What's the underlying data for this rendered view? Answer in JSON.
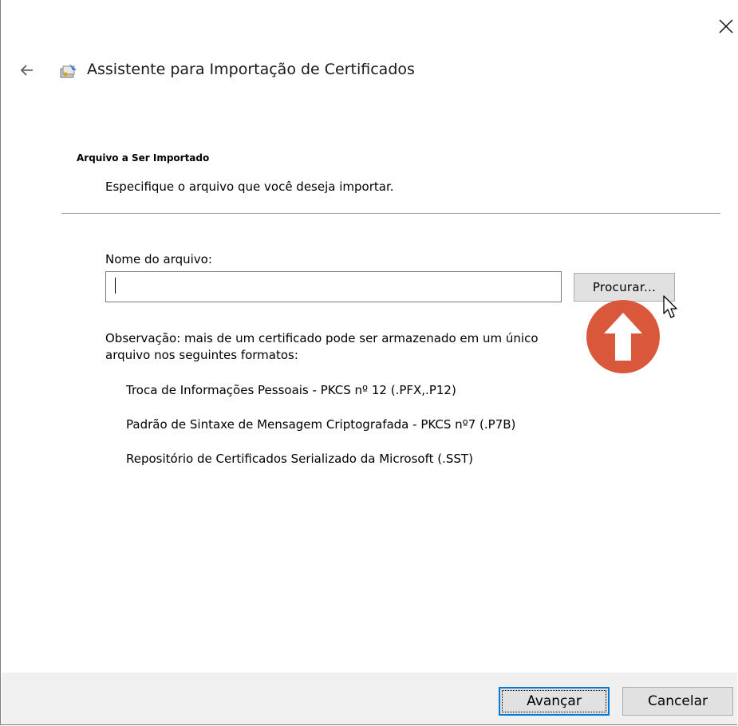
{
  "window": {
    "title": "Assistente para Importação de Certificados"
  },
  "page": {
    "heading": "Arquivo a Ser Importado",
    "subheading": "Especifique o arquivo que você deseja importar."
  },
  "file": {
    "label": "Nome do arquivo:",
    "value": "",
    "browse_label": "Procurar..."
  },
  "note": {
    "text": "Observação: mais de um certificado pode ser armazenado em um único arquivo nos seguintes formatos:"
  },
  "formats": [
    "Troca de Informações Pessoais - PKCS nº 12 (.PFX,.P12)",
    "Padrão de Sintaxe de Mensagem Criptografada - PKCS nº7 (.P7B)",
    "Repositório de Certificados Serializado da Microsoft (.SST)"
  ],
  "buttons": {
    "next": "Avançar",
    "cancel": "Cancelar"
  },
  "annotation": {
    "badge_color": "#d9573b",
    "icon": "up-arrow-icon"
  }
}
